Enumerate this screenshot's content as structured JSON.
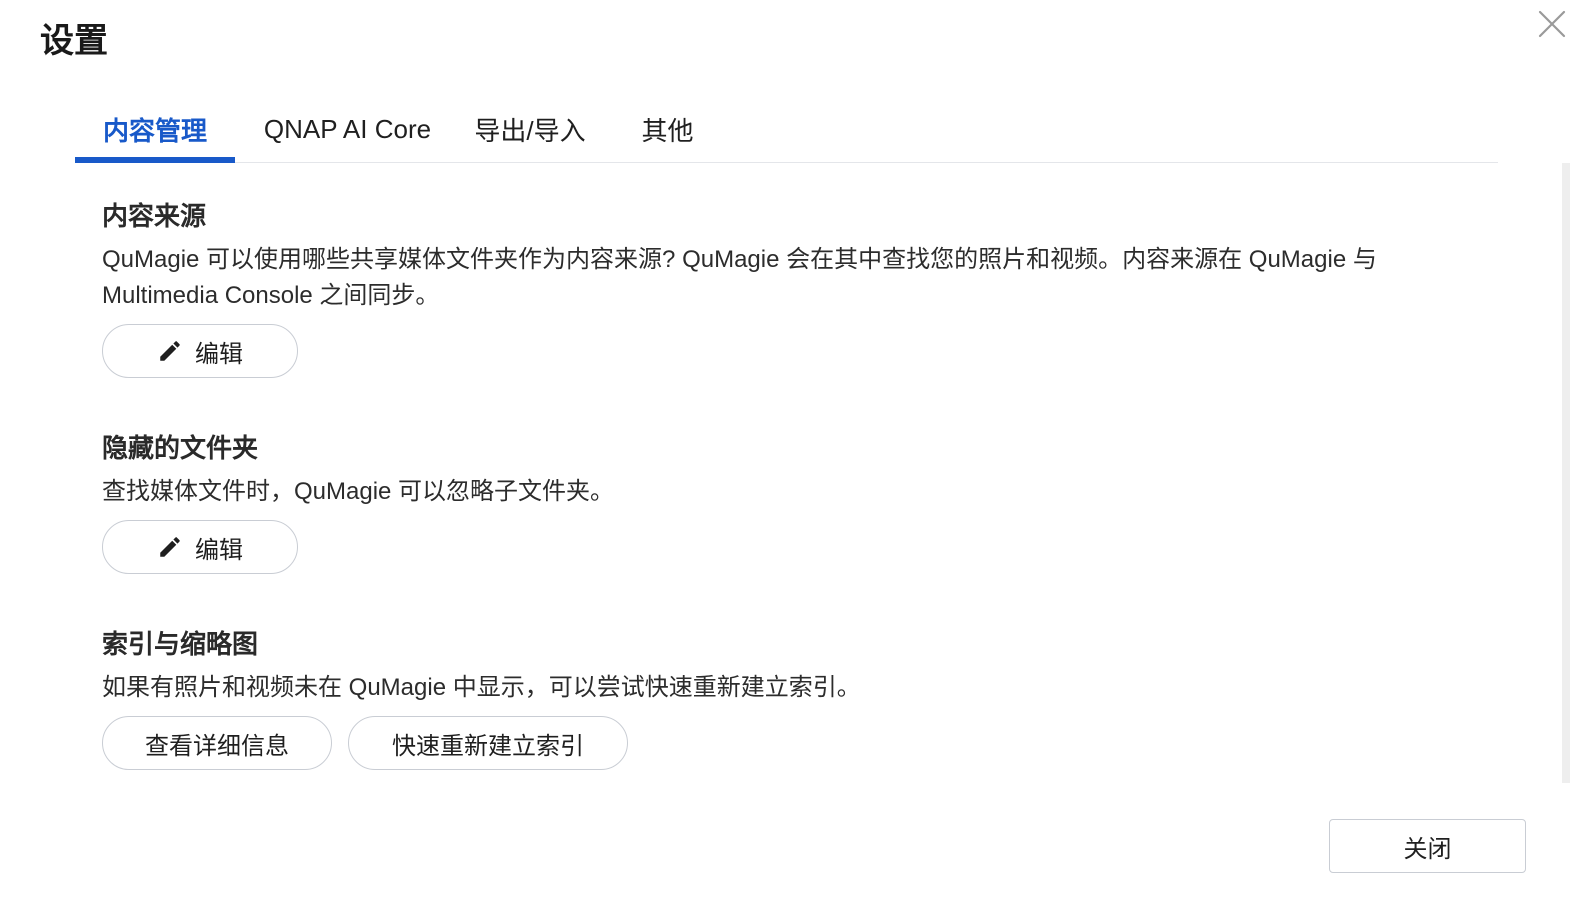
{
  "dialog": {
    "title": "设置",
    "close_icon": "close-x-icon"
  },
  "tabs": [
    {
      "label": "内容管理",
      "active": true
    },
    {
      "label": "QNAP AI Core",
      "active": false
    },
    {
      "label": "导出/导入",
      "active": false
    },
    {
      "label": "其他",
      "active": false
    }
  ],
  "sections": {
    "content_source": {
      "title": "内容来源",
      "description": "QuMagie 可以使用哪些共享媒体文件夹作为内容来源? QuMagie 会在其中查找您的照片和视频。内容来源在 QuMagie 与 Multimedia Console 之间同步。",
      "edit_label": "编辑",
      "edit_icon": "pencil-icon"
    },
    "hidden_folders": {
      "title": "隐藏的文件夹",
      "description": "查找媒体文件时，QuMagie 可以忽略子文件夹。",
      "edit_label": "编辑",
      "edit_icon": "pencil-icon"
    },
    "index_thumbnails": {
      "title": "索引与缩略图",
      "description": "如果有照片和视频未在 QuMagie 中显示，可以尝试快速重新建立索引。",
      "details_label": "查看详细信息",
      "reindex_label": "快速重新建立索引"
    }
  },
  "footer": {
    "close_label": "关闭"
  },
  "colors": {
    "accent": "#1859c9",
    "border": "#c9cdd4",
    "divider": "#e4e6ea"
  }
}
